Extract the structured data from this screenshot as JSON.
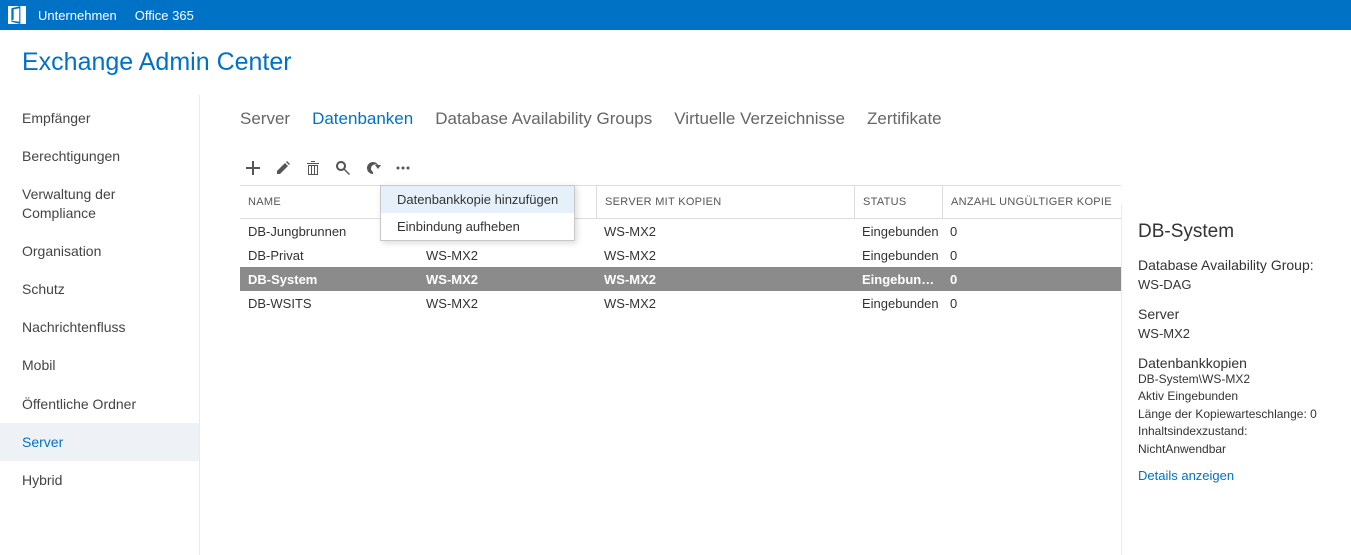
{
  "topbar": {
    "company": "Unternehmen",
    "office": "Office 365"
  },
  "page_title": "Exchange Admin Center",
  "sidebar": {
    "items": [
      "Empfänger",
      "Berechtigungen",
      "Verwaltung der Compliance",
      "Organisation",
      "Schutz",
      "Nachrichtenfluss",
      "Mobil",
      "Öffentliche Ordner",
      "Server",
      "Hybrid"
    ],
    "active_index": 8
  },
  "tabs": {
    "items": [
      "Server",
      "Datenbanken",
      "Database Availability Groups",
      "Virtuelle Verzeichnisse",
      "Zertifikate"
    ],
    "active_index": 1
  },
  "context_menu": {
    "items": [
      "Datenbankkopie hinzufügen",
      "Einbindung aufheben"
    ],
    "hover_index": 0
  },
  "grid": {
    "columns": [
      "NAME",
      "",
      "SERVER MIT KOPIEN",
      "STATUS",
      "ANZAHL UNGÜLTIGER KOPIEN"
    ],
    "rows": [
      {
        "name": "DB-Jungbrunnen",
        "server": "",
        "copies": "WS-MX2",
        "status": "Eingebunden",
        "invalid": "0",
        "selected": false
      },
      {
        "name": "DB-Privat",
        "server": "WS-MX2",
        "copies": "WS-MX2",
        "status": "Eingebunden",
        "invalid": "0",
        "selected": false
      },
      {
        "name": "DB-System",
        "server": "WS-MX2",
        "copies": "WS-MX2",
        "status": "Eingebund…",
        "invalid": "0",
        "selected": true
      },
      {
        "name": "DB-WSITS",
        "server": "WS-MX2",
        "copies": "WS-MX2",
        "status": "Eingebunden",
        "invalid": "0",
        "selected": false
      }
    ]
  },
  "details": {
    "title": "DB-System",
    "dag_label": "Database Availability Group:",
    "dag_value": "WS-DAG",
    "server_label": "Server",
    "server_value": "WS-MX2",
    "copies_label": "Datenbankkopien",
    "copy_name": "DB-System\\WS-MX2",
    "copy_status": "Aktiv Eingebunden",
    "queue": "Länge der Kopiewarteschlange:  0",
    "index": "Inhaltsindexzustand:  NichtAnwendbar",
    "link": "Details anzeigen"
  }
}
